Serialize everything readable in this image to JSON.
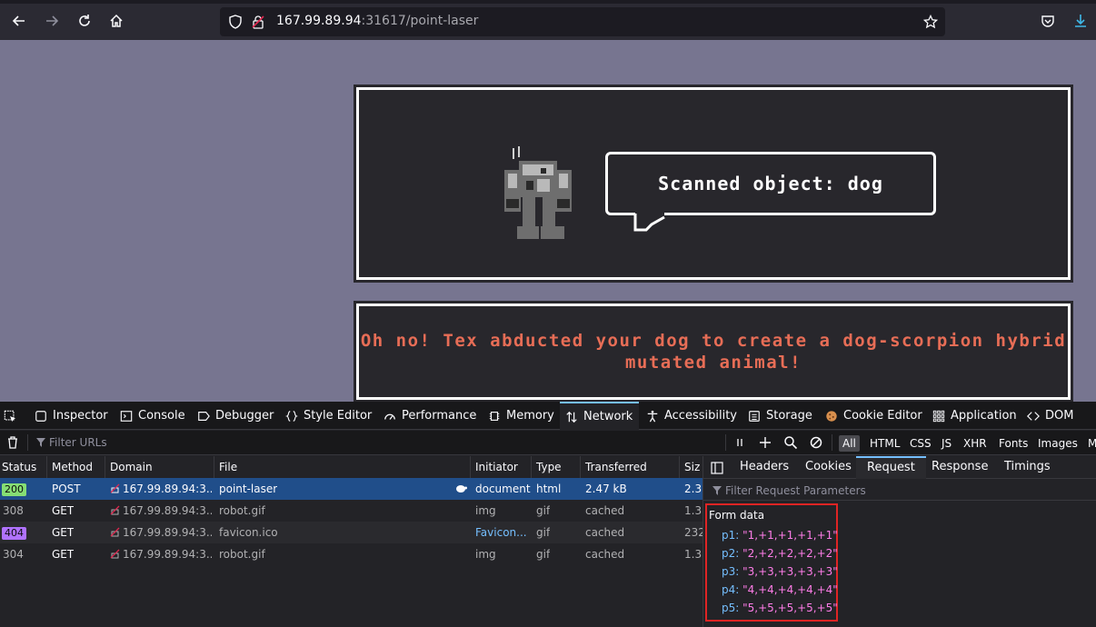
{
  "browser": {
    "url_host": "167.99.89.94",
    "url_rest": ":31617/point-laser"
  },
  "page": {
    "speech_bubble": "Scanned object: dog",
    "message": "Oh no! Tex abducted your dog to create a dog-scorpion hybrid mutated animal!"
  },
  "devtools": {
    "tabs": [
      {
        "label": "Inspector",
        "icon": "inspector-icon"
      },
      {
        "label": "Console",
        "icon": "console-icon"
      },
      {
        "label": "Debugger",
        "icon": "debugger-icon"
      },
      {
        "label": "Style Editor",
        "icon": "braces-icon"
      },
      {
        "label": "Performance",
        "icon": "gauge-icon"
      },
      {
        "label": "Memory",
        "icon": "memory-chip-icon"
      },
      {
        "label": "Network",
        "icon": "arrows-updown-icon"
      },
      {
        "label": "Accessibility",
        "icon": "accessibility-icon"
      },
      {
        "label": "Storage",
        "icon": "storage-icon"
      },
      {
        "label": "Cookie Editor",
        "icon": "cookie-icon"
      },
      {
        "label": "Application",
        "icon": "grid-icon"
      },
      {
        "label": "DOM",
        "icon": "code-icon"
      }
    ],
    "selected_tab": "Network",
    "filter_placeholder": "Filter URLs",
    "type_filters": [
      "All",
      "HTML",
      "CSS",
      "JS",
      "XHR",
      "Fonts",
      "Images",
      "M"
    ],
    "active_type_filter": "All",
    "columns": [
      "Status",
      "Method",
      "Domain",
      "File",
      "Initiator",
      "Type",
      "Transferred",
      "Siz"
    ],
    "requests": [
      {
        "status": "200",
        "method": "POST",
        "domain": "167.99.89.94:3...",
        "file": "point-laser",
        "initiator": "document",
        "type": "html",
        "transferred": "2.47 kB",
        "size": "2.3"
      },
      {
        "status": "308",
        "method": "GET",
        "domain": "167.99.89.94:3...",
        "file": "robot.gif",
        "initiator": "img",
        "type": "gif",
        "transferred": "cached",
        "size": "1.3"
      },
      {
        "status": "404",
        "method": "GET",
        "domain": "167.99.89.94:3...",
        "file": "favicon.ico",
        "initiator": "Favicon...",
        "type": "gif",
        "transferred": "cached",
        "size": "232"
      },
      {
        "status": "304",
        "method": "GET",
        "domain": "167.99.89.94:3...",
        "file": "robot.gif",
        "initiator": "img",
        "type": "gif",
        "transferred": "cached",
        "size": "1.3"
      }
    ],
    "side_tabs": [
      "Headers",
      "Cookies",
      "Request",
      "Response",
      "Timings"
    ],
    "selected_side_tab": "Request",
    "params_filter_placeholder": "Filter Request Parameters",
    "form_data_title": "Form data",
    "form_data": [
      {
        "key": "p1:",
        "value": "\"1,+1,+1,+1,+1\""
      },
      {
        "key": "p2:",
        "value": "\"2,+2,+2,+2,+2\""
      },
      {
        "key": "p3:",
        "value": "\"3,+3,+3,+3,+3\""
      },
      {
        "key": "p4:",
        "value": "\"4,+4,+4,+4,+4\""
      },
      {
        "key": "p5:",
        "value": "\"5,+5,+5,+5,+5\""
      }
    ]
  },
  "colors": {
    "page_background": "#777590",
    "panel_background": "#28272c",
    "message_text": "#e76d56",
    "selected_row": "#204e8a",
    "highlight_box": "#e02424"
  }
}
